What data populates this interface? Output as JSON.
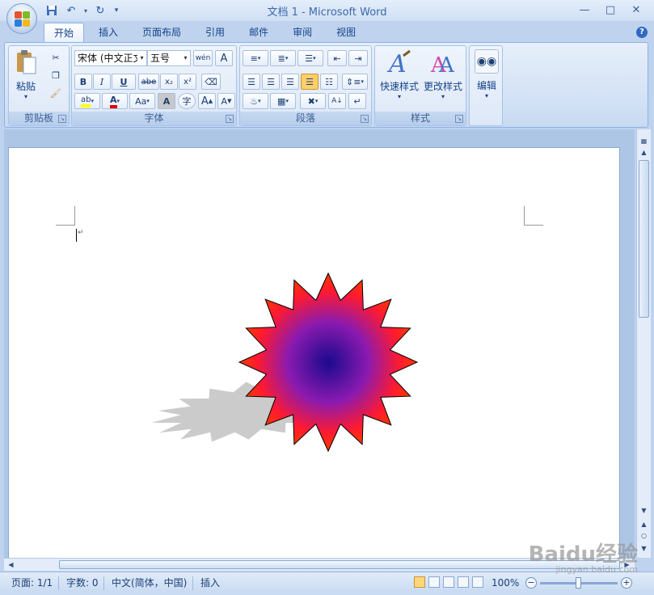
{
  "window": {
    "title": "文档 1 - Microsoft Word",
    "controls": [
      "minimize-icon",
      "restore-icon",
      "close-icon"
    ]
  },
  "qat": {
    "items": [
      "save-icon",
      "undo-icon",
      "redo-icon",
      "customize-icon"
    ]
  },
  "tabs": [
    {
      "label": "开始",
      "active": true
    },
    {
      "label": "插入"
    },
    {
      "label": "页面布局"
    },
    {
      "label": "引用"
    },
    {
      "label": "邮件"
    },
    {
      "label": "审阅"
    },
    {
      "label": "视图"
    }
  ],
  "ribbon": {
    "clipboard": {
      "label": "剪贴板",
      "paste": "粘贴"
    },
    "font": {
      "label": "字体",
      "font_name": "宋体 (中文正文)",
      "font_size": "五号",
      "bold": "B",
      "italic": "I",
      "underline": "U",
      "strike": "abe",
      "subscript": "x₂",
      "superscript": "x²",
      "font_color_letter": "A",
      "change_case": "Aa",
      "grow": "A",
      "shrink": "A",
      "wen": "wén",
      "encircle": "字"
    },
    "paragraph": {
      "label": "段落"
    },
    "styles": {
      "label": "样式",
      "quick_styles": "快速样式",
      "change_styles": "更改样式"
    },
    "editing": {
      "label": "编辑"
    }
  },
  "status": {
    "page": "页面: 1/1",
    "words": "字数: 0",
    "language": "中文(简体，中国)",
    "mode": "插入",
    "zoom": "100%",
    "zoom_value": 1.0
  },
  "colors": {
    "star_center": "#1a0a8c",
    "star_edge": "#ff2200",
    "star_outline": "#000000",
    "shadow": "#c8c8c8",
    "ribbon_border": "#8db2e3"
  },
  "watermark": {
    "brand": "Baidu经验",
    "url": "jingyan.baidu.com"
  }
}
